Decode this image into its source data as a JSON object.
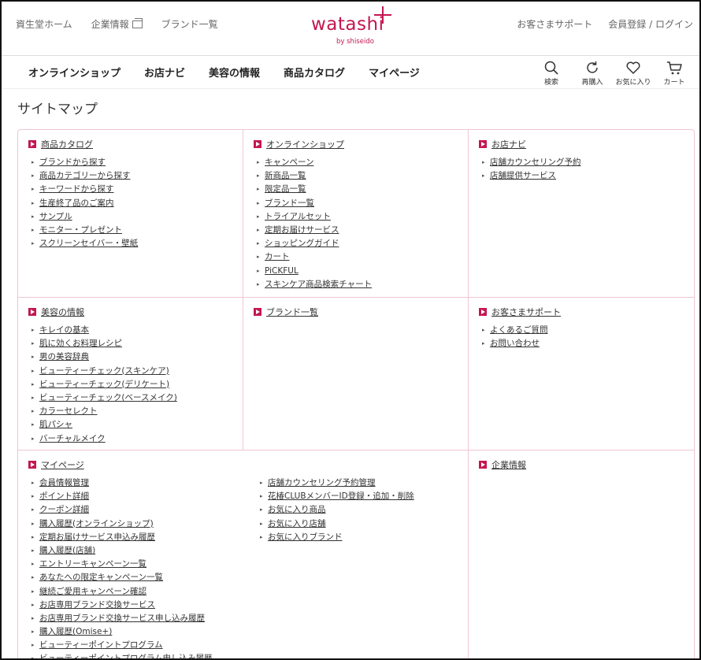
{
  "header": {
    "left_links": [
      "資生堂ホーム",
      "企業情報",
      "ブランド一覧"
    ],
    "logo": {
      "main": "watashi",
      "sub": "by shiseido"
    },
    "right_links": {
      "support": "お客さまサポート",
      "register": "会員登録",
      "sep": "/",
      "login": "ログイン"
    }
  },
  "mainnav": [
    "オンラインショップ",
    "お店ナビ",
    "美容の情報",
    "商品カタログ",
    "マイページ"
  ],
  "icons": [
    {
      "name": "search-icon",
      "label": "検索"
    },
    {
      "name": "reorder-icon",
      "label": "再購入"
    },
    {
      "name": "heart-icon",
      "label": "お気に入り"
    },
    {
      "name": "cart-icon",
      "label": "カート"
    }
  ],
  "page_title": "サイトマップ",
  "sections": {
    "catalog": {
      "title": "商品カタログ",
      "items": [
        "ブランドから探す",
        "商品カテゴリーから探す",
        "キーワードから探す",
        "生産終了品のご案内",
        "サンプル",
        "モニター・プレゼント",
        "スクリーンセイバー・壁紙"
      ]
    },
    "online": {
      "title": "オンラインショップ",
      "items": [
        "キャンペーン",
        "新商品一覧",
        "限定品一覧",
        "ブランド一覧",
        "トライアルセット",
        "定期お届けサービス",
        "ショッピングガイド",
        "カート",
        "PiCKFUL",
        "スキンケア商品検索チャート"
      ]
    },
    "shopnavi": {
      "title": "お店ナビ",
      "items": [
        "店舗カウンセリング予約",
        "店舗提供サービス"
      ]
    },
    "beauty": {
      "title": "美容の情報",
      "items": [
        "キレイの基本",
        "肌に効くお料理レシピ",
        "男の美容辞典",
        "ビューティーチェック(スキンケア)",
        "ビューティーチェック(デリケート)",
        "ビューティーチェック(ベースメイク)",
        "カラーセレクト",
        "肌パシャ",
        "バーチャルメイク"
      ]
    },
    "brands": {
      "title": "ブランド一覧",
      "items": []
    },
    "support": {
      "title": "お客さまサポート",
      "items": [
        "よくあるご質問",
        "お問い合わせ"
      ]
    },
    "mypage": {
      "title": "マイページ",
      "col1": [
        "会員情報管理",
        "ポイント詳細",
        "クーポン詳細",
        "購入履歴(オンラインショップ)",
        "定期お届けサービス申込み履歴",
        "購入履歴(店舗)",
        "エントリーキャンペーン一覧",
        "あなたへの限定キャンペーン一覧",
        "継続ご愛用キャンペーン確認",
        "お店専用ブランド交換サービス",
        "お店専用ブランド交換サービス申し込み履歴",
        "購入履歴(Omise+)",
        "ビューティーポイントプログラム",
        "ビューティーポイントプログラム申し込み履歴"
      ],
      "col2": [
        "店舗カウンセリング予約管理",
        "花椿CLUBメンバーID登録・追加・削除",
        "お気に入り商品",
        "お気に入り店舗",
        "お気に入りブランド"
      ]
    },
    "corporate": {
      "title": "企業情報",
      "items": []
    }
  },
  "colors": {
    "brand": "#c4174f",
    "border": "#f0c6d3"
  }
}
